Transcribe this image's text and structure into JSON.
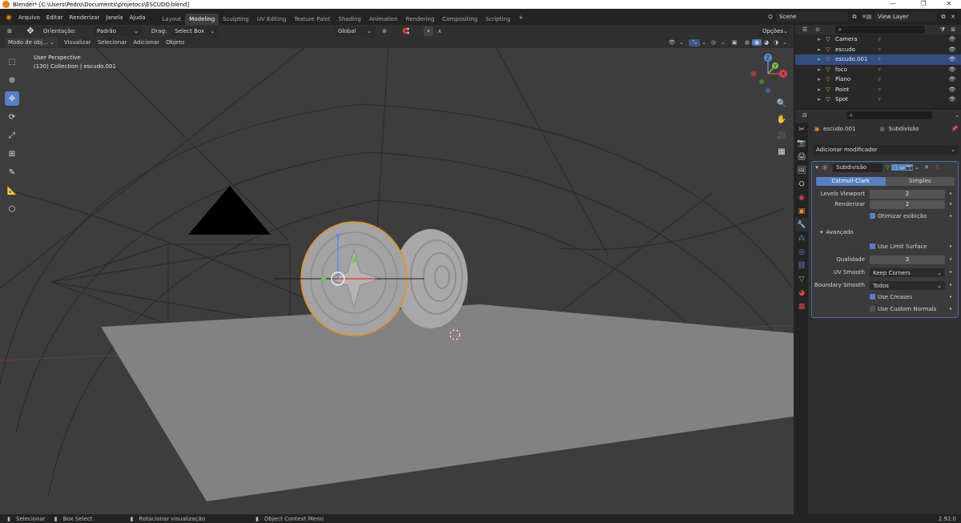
{
  "window": {
    "title": "Blender* [C:\\Users\\Pedro\\Documents\\projetocs\\ESCUDO.blend]",
    "minimize": "—",
    "maximize": "❐",
    "close": "✕"
  },
  "menus": [
    "Arquivo",
    "Editar",
    "Renderizar",
    "Janela",
    "Ajuda"
  ],
  "workspaces": [
    "Layout",
    "Modeling",
    "Sculpting",
    "UV Editing",
    "Texture Paint",
    "Shading",
    "Animation",
    "Rendering",
    "Compositing",
    "Scripting"
  ],
  "active_workspace": "Modeling",
  "add_workspace": "+",
  "scene": {
    "name": "Scene",
    "view_layer": "View Layer"
  },
  "tool_header": {
    "orientation_label": "Orientação:",
    "orientation_value": "Padrão",
    "drag_label": "Drag:",
    "drag_value": "Select Box",
    "transform": "Global",
    "options": "Opções"
  },
  "view_header": {
    "mode": "Modo de obj...",
    "items": [
      "Visualizar",
      "Selecionar",
      "Adicionar",
      "Objeto"
    ]
  },
  "viewport": {
    "line1": "User Perspective",
    "line2": "(130) Collection | escudo.001"
  },
  "gizmo": {
    "z": "Z",
    "x": "X",
    "y": "Y"
  },
  "outliner": [
    {
      "name": "Camera",
      "selected": false,
      "icon_color": "#d0d0d0"
    },
    {
      "name": "escudo",
      "selected": false,
      "icon_color": "#e08f3a"
    },
    {
      "name": "escudo.001",
      "selected": true,
      "icon_color": "#e08f3a"
    },
    {
      "name": "foco",
      "selected": false,
      "icon_color": "#f0c040"
    },
    {
      "name": "Plano",
      "selected": false,
      "icon_color": "#e08f3a"
    },
    {
      "name": "Point",
      "selected": false,
      "icon_color": "#f0c040"
    },
    {
      "name": "Spot",
      "selected": false,
      "icon_color": "#f0c040"
    }
  ],
  "properties": {
    "object": "escudo.001",
    "modifier_context": "Subdivisão",
    "add_modifier": "Adicionar modificador",
    "modifier": {
      "name": "Subdivisão",
      "mode_catmull": "Catmull-Clark",
      "mode_simple": "Simples",
      "levels_viewport_label": "Levels Viewport",
      "levels_viewport": "2",
      "render_label": "Renderizar",
      "render": "2",
      "optimize": "Otimizar exibição",
      "advanced": "Avançado",
      "use_limit": "Use Limit Surface",
      "quality_label": "Qualidade",
      "quality": "3",
      "uv_smooth_label": "UV Smooth",
      "uv_smooth": "Keep Corners",
      "boundary_label": "Boundary Smooth",
      "boundary": "Todos",
      "use_creases": "Use Creases",
      "use_custom": "Use Custom Normals"
    }
  },
  "status": {
    "select": "Selecionar",
    "box": "Box Select",
    "rotate": "Rotacionar visualização",
    "context": "Object Context Menu",
    "version": "2.92.0"
  }
}
